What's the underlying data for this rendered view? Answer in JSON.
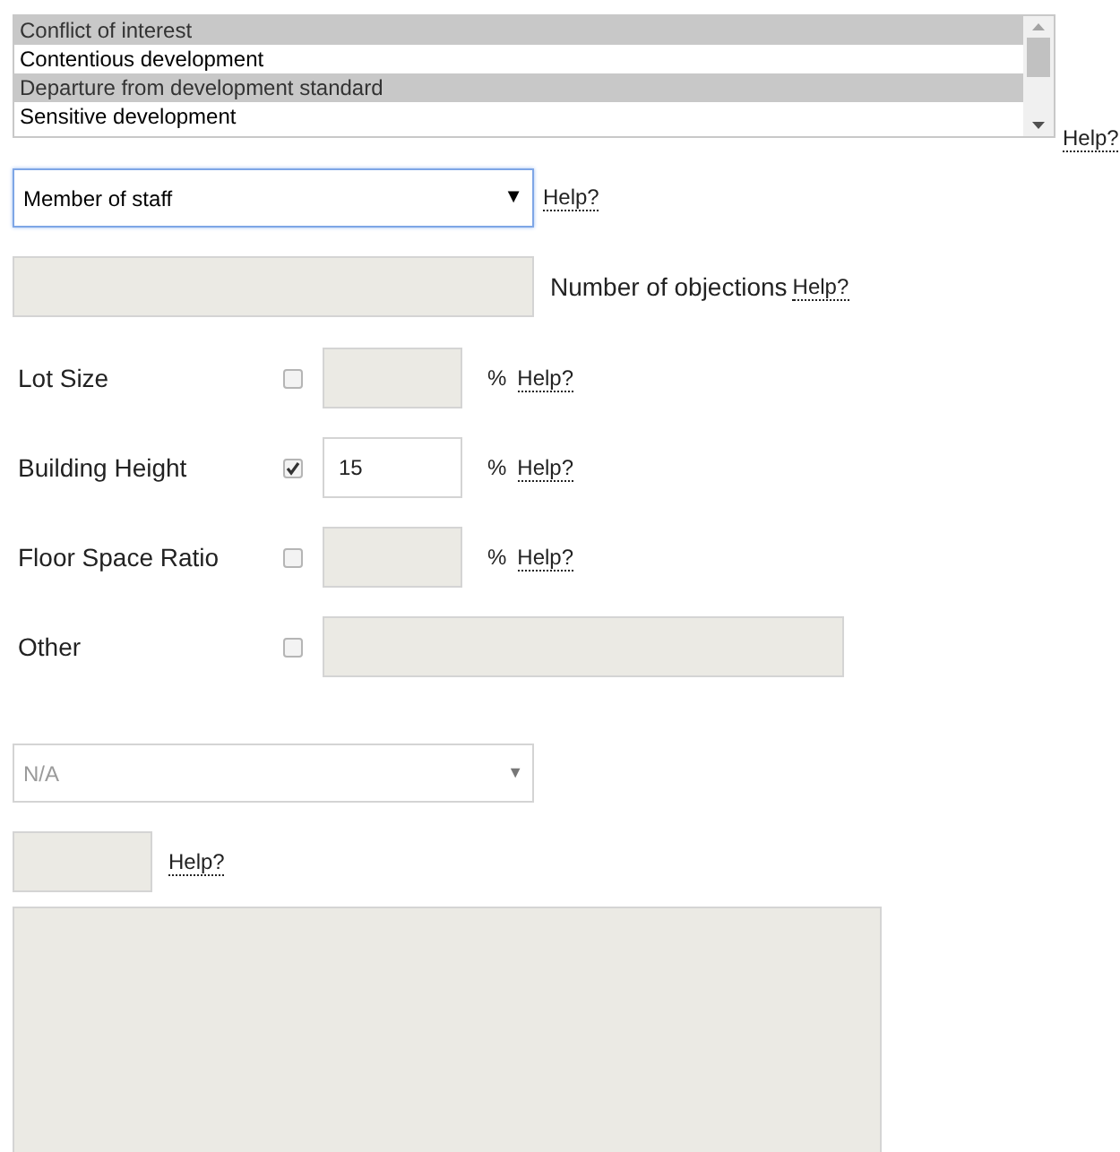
{
  "listbox": {
    "items": [
      {
        "label": "Conflict of interest",
        "selected": true
      },
      {
        "label": "Contentious development",
        "selected": false
      },
      {
        "label": "Departure from development standard",
        "selected": true
      },
      {
        "label": "Sensitive development",
        "selected": false
      }
    ],
    "help": "Help?"
  },
  "staff_select": {
    "value": "Member of staff",
    "focused": true,
    "disabled": false,
    "arrow": "▼",
    "help": "Help?"
  },
  "objections": {
    "disabled": true,
    "label": "Number of objections",
    "help": "Help?"
  },
  "variations": [
    {
      "kind": "percent",
      "label": "Lot Size",
      "checked": false,
      "disabled": true,
      "unit": "%",
      "help": "Help?"
    },
    {
      "kind": "percent",
      "label": "Building Height",
      "checked": true,
      "disabled": false,
      "value": "15",
      "unit": "%",
      "help": "Help?"
    },
    {
      "kind": "percent",
      "label": "Floor Space Ratio",
      "checked": false,
      "disabled": true,
      "unit": "%",
      "help": "Help?"
    },
    {
      "kind": "text",
      "label": "Other",
      "checked": false,
      "disabled": true
    }
  ],
  "na_select": {
    "value": "N/A",
    "focused": false,
    "disabled": true,
    "arrow": "▼"
  },
  "small_field": {
    "disabled": true,
    "help": "Help?"
  },
  "notes": {
    "disabled": true
  }
}
